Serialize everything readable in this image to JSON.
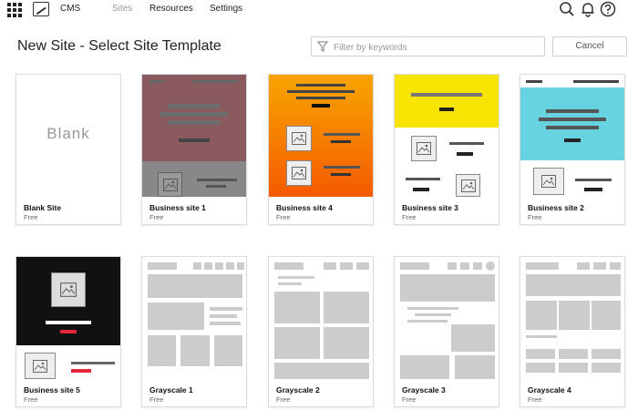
{
  "app": {
    "name": "CMS"
  },
  "nav": {
    "sites": "Sites",
    "resources": "Resources",
    "settings": "Settings"
  },
  "page": {
    "title": "New Site - Select Site Template"
  },
  "filter": {
    "placeholder": "Filter by keywords"
  },
  "actions": {
    "cancel": "Cancel"
  },
  "colors": {
    "accent_red": "#e4273a",
    "yellow": "#f7e400",
    "cyan": "#67d3e0",
    "mauve": "#8a5a5e",
    "orange_top": "#f7a500",
    "orange_bottom": "#f55a00",
    "dark": "#111111"
  },
  "templates": [
    {
      "name": "Blank Site",
      "price": "Free",
      "thumb_text": "Blank"
    },
    {
      "name": "Business site 1",
      "price": "Free"
    },
    {
      "name": "Business site 4",
      "price": "Free"
    },
    {
      "name": "Business site 3",
      "price": "Free"
    },
    {
      "name": "Business site 2",
      "price": "Free"
    },
    {
      "name": "Business site 5",
      "price": "Free"
    },
    {
      "name": "Grayscale 1",
      "price": "Free"
    },
    {
      "name": "Grayscale 2",
      "price": "Free"
    },
    {
      "name": "Grayscale 3",
      "price": "Free"
    },
    {
      "name": "Grayscale 4",
      "price": "Free"
    }
  ]
}
